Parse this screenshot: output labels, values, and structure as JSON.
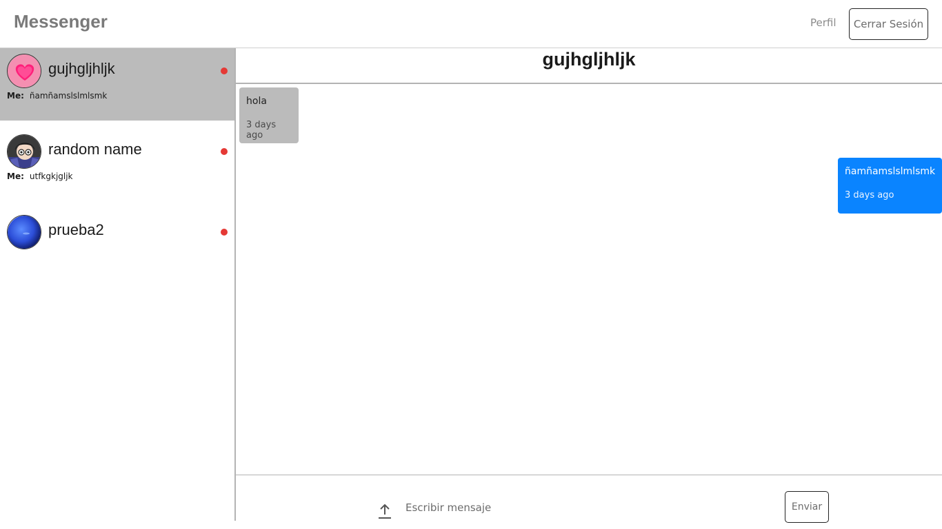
{
  "navbar": {
    "brand": "Messenger",
    "profile_link": "Perfil",
    "logout_button": "Cerrar Sesión"
  },
  "sidebar": {
    "conversations": [
      {
        "name": "gujhgljhljk",
        "avatar_icon": "pink-heart-avatar",
        "last_sender": "Me:",
        "last_message": "ñamñamslslmlsmk",
        "status_color": "#e53935",
        "active": true
      },
      {
        "name": "random name",
        "avatar_icon": "anime-character-avatar",
        "last_sender": "Me:",
        "last_message": "utfkgkjgljk",
        "status_color": "#e53935",
        "active": false
      },
      {
        "name": "prueba2",
        "avatar_icon": "blue-planet-avatar",
        "last_sender": "",
        "last_message": "",
        "status_color": "#e53935",
        "active": false
      }
    ]
  },
  "chat": {
    "title": "gujhgljhljk",
    "messages": [
      {
        "direction": "received",
        "text": "hola",
        "time": "3 days ago"
      },
      {
        "direction": "sent",
        "text": "ñamñamslslmlsmk",
        "time": "3 days ago"
      }
    ]
  },
  "composer": {
    "upload_icon": "upload-arrow-icon",
    "placeholder": "Escribir mensaje",
    "value": "",
    "send_button": "Enviar"
  },
  "colors": {
    "sent_bubble": "#0a84ff",
    "received_bubble": "#bbbbbb",
    "active_conversation": "#bbbbbb",
    "online_dot": "#e53935"
  }
}
